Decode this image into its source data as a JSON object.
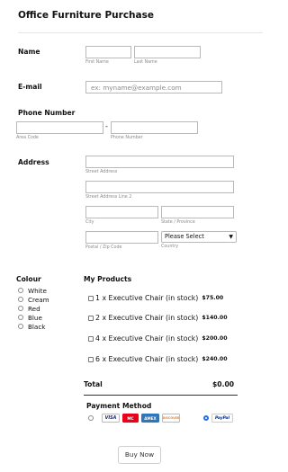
{
  "form": {
    "title": "Office Furniture Purchase",
    "name": {
      "label": "Name",
      "first_sub": "First Name",
      "last_sub": "Last Name"
    },
    "email": {
      "label": "E-mail",
      "placeholder": "ex: myname@example.com"
    },
    "phone": {
      "label": "Phone Number",
      "dash": "-",
      "area_sub": "Area Code",
      "number_sub": "Phone Number"
    },
    "address": {
      "label": "Address",
      "street_sub": "Street Address",
      "street2_sub": "Street Address Line 2",
      "city_sub": "City",
      "state_sub": "State / Province",
      "postal_sub": "Postal / Zip Code",
      "country_sub": "Country",
      "country_value": "Please Select"
    },
    "colour": {
      "label": "Colour",
      "options": [
        "White",
        "Cream",
        "Red",
        "Blue",
        "Black"
      ]
    },
    "products": {
      "label": "My Products",
      "items": [
        {
          "text": "1 x Executive Chair (in stock)",
          "price": "$75.00"
        },
        {
          "text": "2 x Executive Chair (in stock)",
          "price": "$140.00"
        },
        {
          "text": "4 x Executive Chair (in stock)",
          "price": "$200.00"
        },
        {
          "text": "6 x Executive Chair (in stock)",
          "price": "$240.00"
        }
      ],
      "total_label": "Total",
      "total_value": "$0.00"
    },
    "payment": {
      "label": "Payment Method",
      "cards": [
        "VISA",
        "MC",
        "AMEX",
        "DISCOVER"
      ],
      "paypal": "PayPal"
    },
    "submit_label": "Buy Now"
  },
  "colors": {
    "visa": "#1a1f71",
    "mastercard": "#eb001b",
    "amex": "#2e77bb",
    "discover": "#f58220",
    "paypal": "#003087",
    "radio_selected": "#1f6fe5"
  }
}
